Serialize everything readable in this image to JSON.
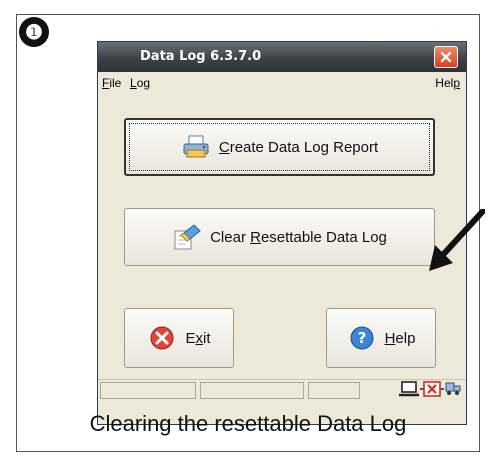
{
  "step_badge": "❶",
  "window": {
    "title": "Data Log 6.3.7.0"
  },
  "menu": {
    "file_first": "F",
    "file_rest": "ile",
    "log_first": "L",
    "log_rest": "og",
    "help_start": "Hel",
    "help_u": "p"
  },
  "buttons": {
    "create_u": "C",
    "create_rest": "reate Data Log Report",
    "clear_pre": "Clear ",
    "clear_u": "R",
    "clear_rest": "esettable Data Log",
    "exit_pre": "E",
    "exit_u": "x",
    "exit_rest": "it",
    "help_u": "H",
    "help_rest": "elp"
  },
  "caption": "Clearing the resettable Data Log"
}
